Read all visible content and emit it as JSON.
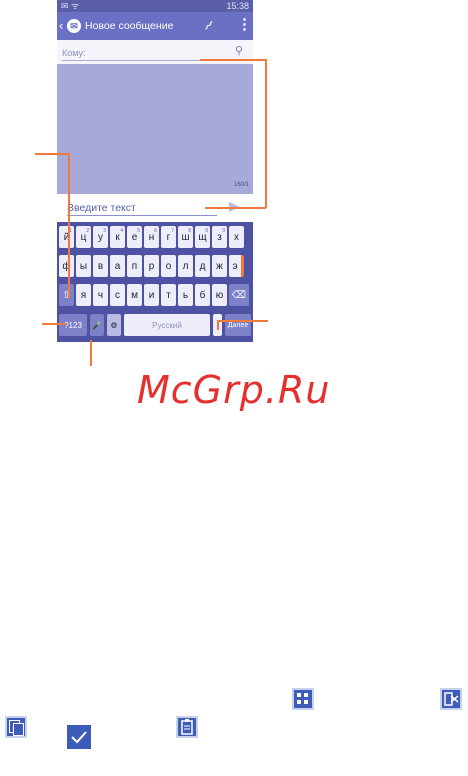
{
  "statusbar": {
    "left_icons": "✉ ᯤ",
    "time": "15:38"
  },
  "app_bar": {
    "back": "‹",
    "title": "Новое сообщение",
    "app_icon": "message-icon",
    "attach_icon": "paperclip-icon",
    "menu_icon": "⋮"
  },
  "recipient": {
    "placeholder": "Кому:",
    "contact_icon": "⚲"
  },
  "compose": {
    "counter": "160/1",
    "input_placeholder": "Введите текст"
  },
  "keyboard": {
    "row1": [
      {
        "char": "й",
        "num": "1"
      },
      {
        "char": "ц",
        "num": "2"
      },
      {
        "char": "у",
        "num": "3"
      },
      {
        "char": "к",
        "num": "4"
      },
      {
        "char": "е",
        "num": "5"
      },
      {
        "char": "н",
        "num": "6"
      },
      {
        "char": "г",
        "num": "7"
      },
      {
        "char": "ш",
        "num": "8"
      },
      {
        "char": "щ",
        "num": "9"
      },
      {
        "char": "з",
        "num": "0"
      },
      {
        "char": "х",
        "num": ""
      }
    ],
    "row2": [
      "ф",
      "ы",
      "в",
      "а",
      "п",
      "р",
      "о",
      "л",
      "д",
      "ж",
      "э"
    ],
    "row3": [
      "⇧",
      "я",
      "ч",
      "с",
      "м",
      "и",
      "т",
      "ь",
      "б",
      "ю",
      "⌫"
    ],
    "row4": {
      "symbols": "?123",
      "mic": "🎤",
      "settings": "⚙",
      "space": "Русский",
      "period": ".",
      "enter": "Далее"
    }
  },
  "watermark": "McGrp.Ru",
  "icons": [
    "grid-icon",
    "cut-icon",
    "copy-icon",
    "paste-icon",
    "check-icon"
  ],
  "accent_color": "#ef7a3c"
}
